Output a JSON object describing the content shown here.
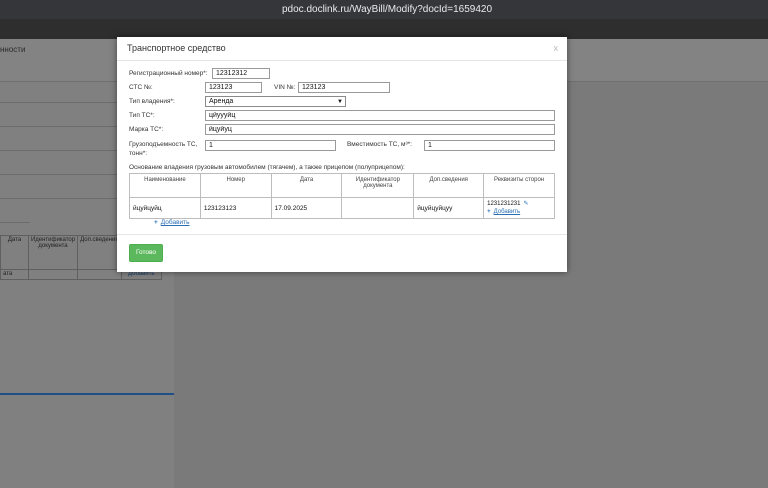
{
  "browser": {
    "url": "pdoc.doclink.ru/WayBill/Modify?docId=1659420"
  },
  "background": {
    "header_text": "нности",
    "table_headers": [
      "Дата",
      "Идентификатор документа",
      "Доп.сведения"
    ],
    "table_row_cell": "ата",
    "add_label": "Добавить"
  },
  "modal": {
    "title": "Транспортное средство",
    "close": "x",
    "reg_number_label": "Регистрационный номер*:",
    "reg_number_value": "12312312",
    "sts_label": "СТС №:",
    "sts_value": "123123",
    "vin_label": "VIN №:",
    "vin_value": "123123",
    "ownership_label": "Тип владения*:",
    "ownership_value": "Аренда",
    "vehicle_type_label": "Тип ТС*:",
    "vehicle_type_value": "цйуууйц",
    "brand_label": "Марка ТС*:",
    "brand_value": "йцуйуц",
    "capacity_label": "Грузоподъемность ТС, тонн*:",
    "capacity_value": "1",
    "volume_label": "Вместимость ТС, м³*:",
    "volume_value": "1",
    "basis_label": "Основание владения грузовым автомобилем (тягачем), а также прицепом (полуприцепом):",
    "table": {
      "headers": [
        "Наименование",
        "Номер",
        "Дата",
        "Идентификатор документа",
        "Доп.сведения",
        "Реквизиты сторон"
      ],
      "row": [
        "йцуйцуйц",
        "123123123",
        "17.09.2025",
        "",
        "йцуйцуйцуу",
        "1231231231"
      ]
    },
    "row_add_label": "Добавить",
    "add_label": "Добавить",
    "done_label": "Готово"
  }
}
